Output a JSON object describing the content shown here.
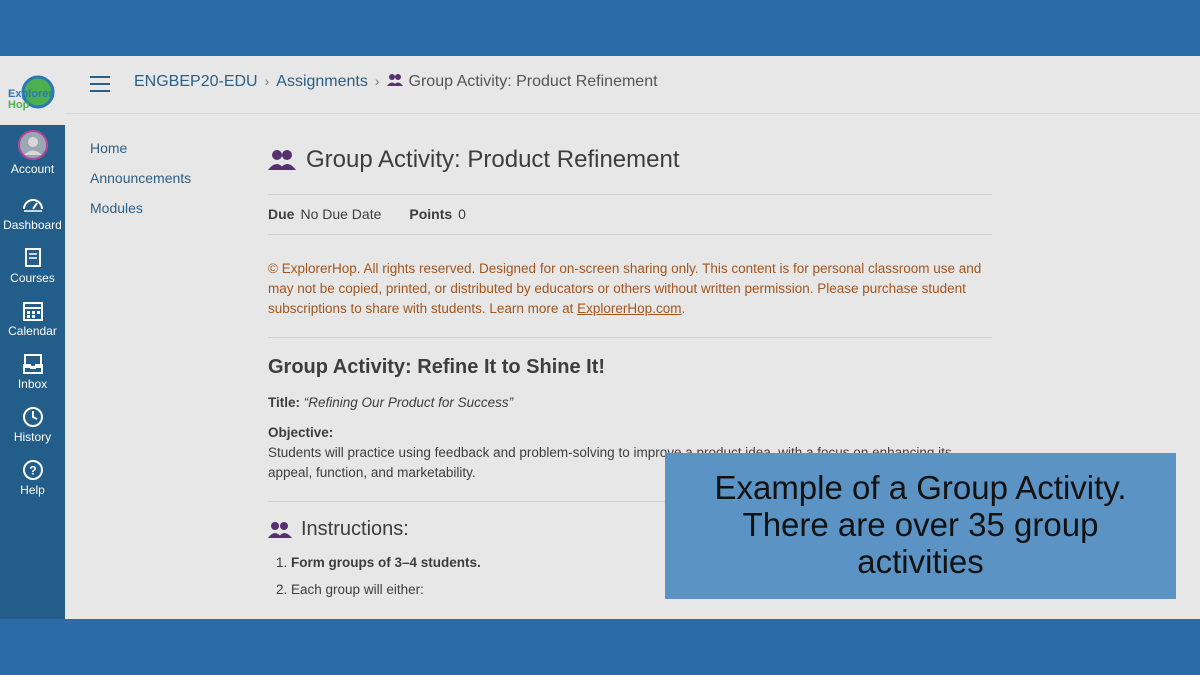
{
  "gnav": {
    "logo_text": "Explorer Hop",
    "items": [
      {
        "label": "Account",
        "icon": "account-avatar-icon"
      },
      {
        "label": "Dashboard",
        "icon": "dashboard-icon"
      },
      {
        "label": "Courses",
        "icon": "courses-icon"
      },
      {
        "label": "Calendar",
        "icon": "calendar-icon"
      },
      {
        "label": "Inbox",
        "icon": "inbox-icon"
      },
      {
        "label": "History",
        "icon": "history-icon"
      },
      {
        "label": "Help",
        "icon": "help-icon"
      }
    ]
  },
  "breadcrumb": {
    "course": "ENGBEP20-EDU",
    "section": "Assignments",
    "current": "Group Activity: Product Refinement"
  },
  "course_nav": [
    "Home",
    "Announcements",
    "Modules"
  ],
  "assignment": {
    "title": "Group Activity: Product Refinement",
    "due_label": "Due",
    "due_value": "No Due Date",
    "points_label": "Points",
    "points_value": "0",
    "copyright_text": "© ExplorerHop. All rights reserved. Designed for on-screen sharing only. This content is for personal classroom use and may not be copied, printed, or distributed by educators or others without written permission. Please purchase student subscriptions to share with students. Learn more at ",
    "copyright_link": "ExplorerHop.com",
    "copyright_end": ".",
    "heading": "Group Activity: Refine It to Shine It!",
    "title_label": "Title:",
    "title_value": "“Refining Our Product for Success”",
    "objective_label": "Objective:",
    "objective_text": "Students will practice using feedback and problem-solving to improve a product idea, with a focus on enhancing its appeal, function, and marketability.",
    "instructions_heading": "Instructions:",
    "step1": "Form groups of 3–4 students.",
    "step2": "Each group will either:"
  },
  "caption": {
    "line1": "Example of a Group Activity.",
    "line2": "There are over 35 group",
    "line3": "activities"
  },
  "colors": {
    "nav": "#235d8a",
    "band": "#2b6ba7",
    "link": "#2d5f86",
    "copyright": "#a5551b",
    "caption_bg": "#5b93c4"
  }
}
